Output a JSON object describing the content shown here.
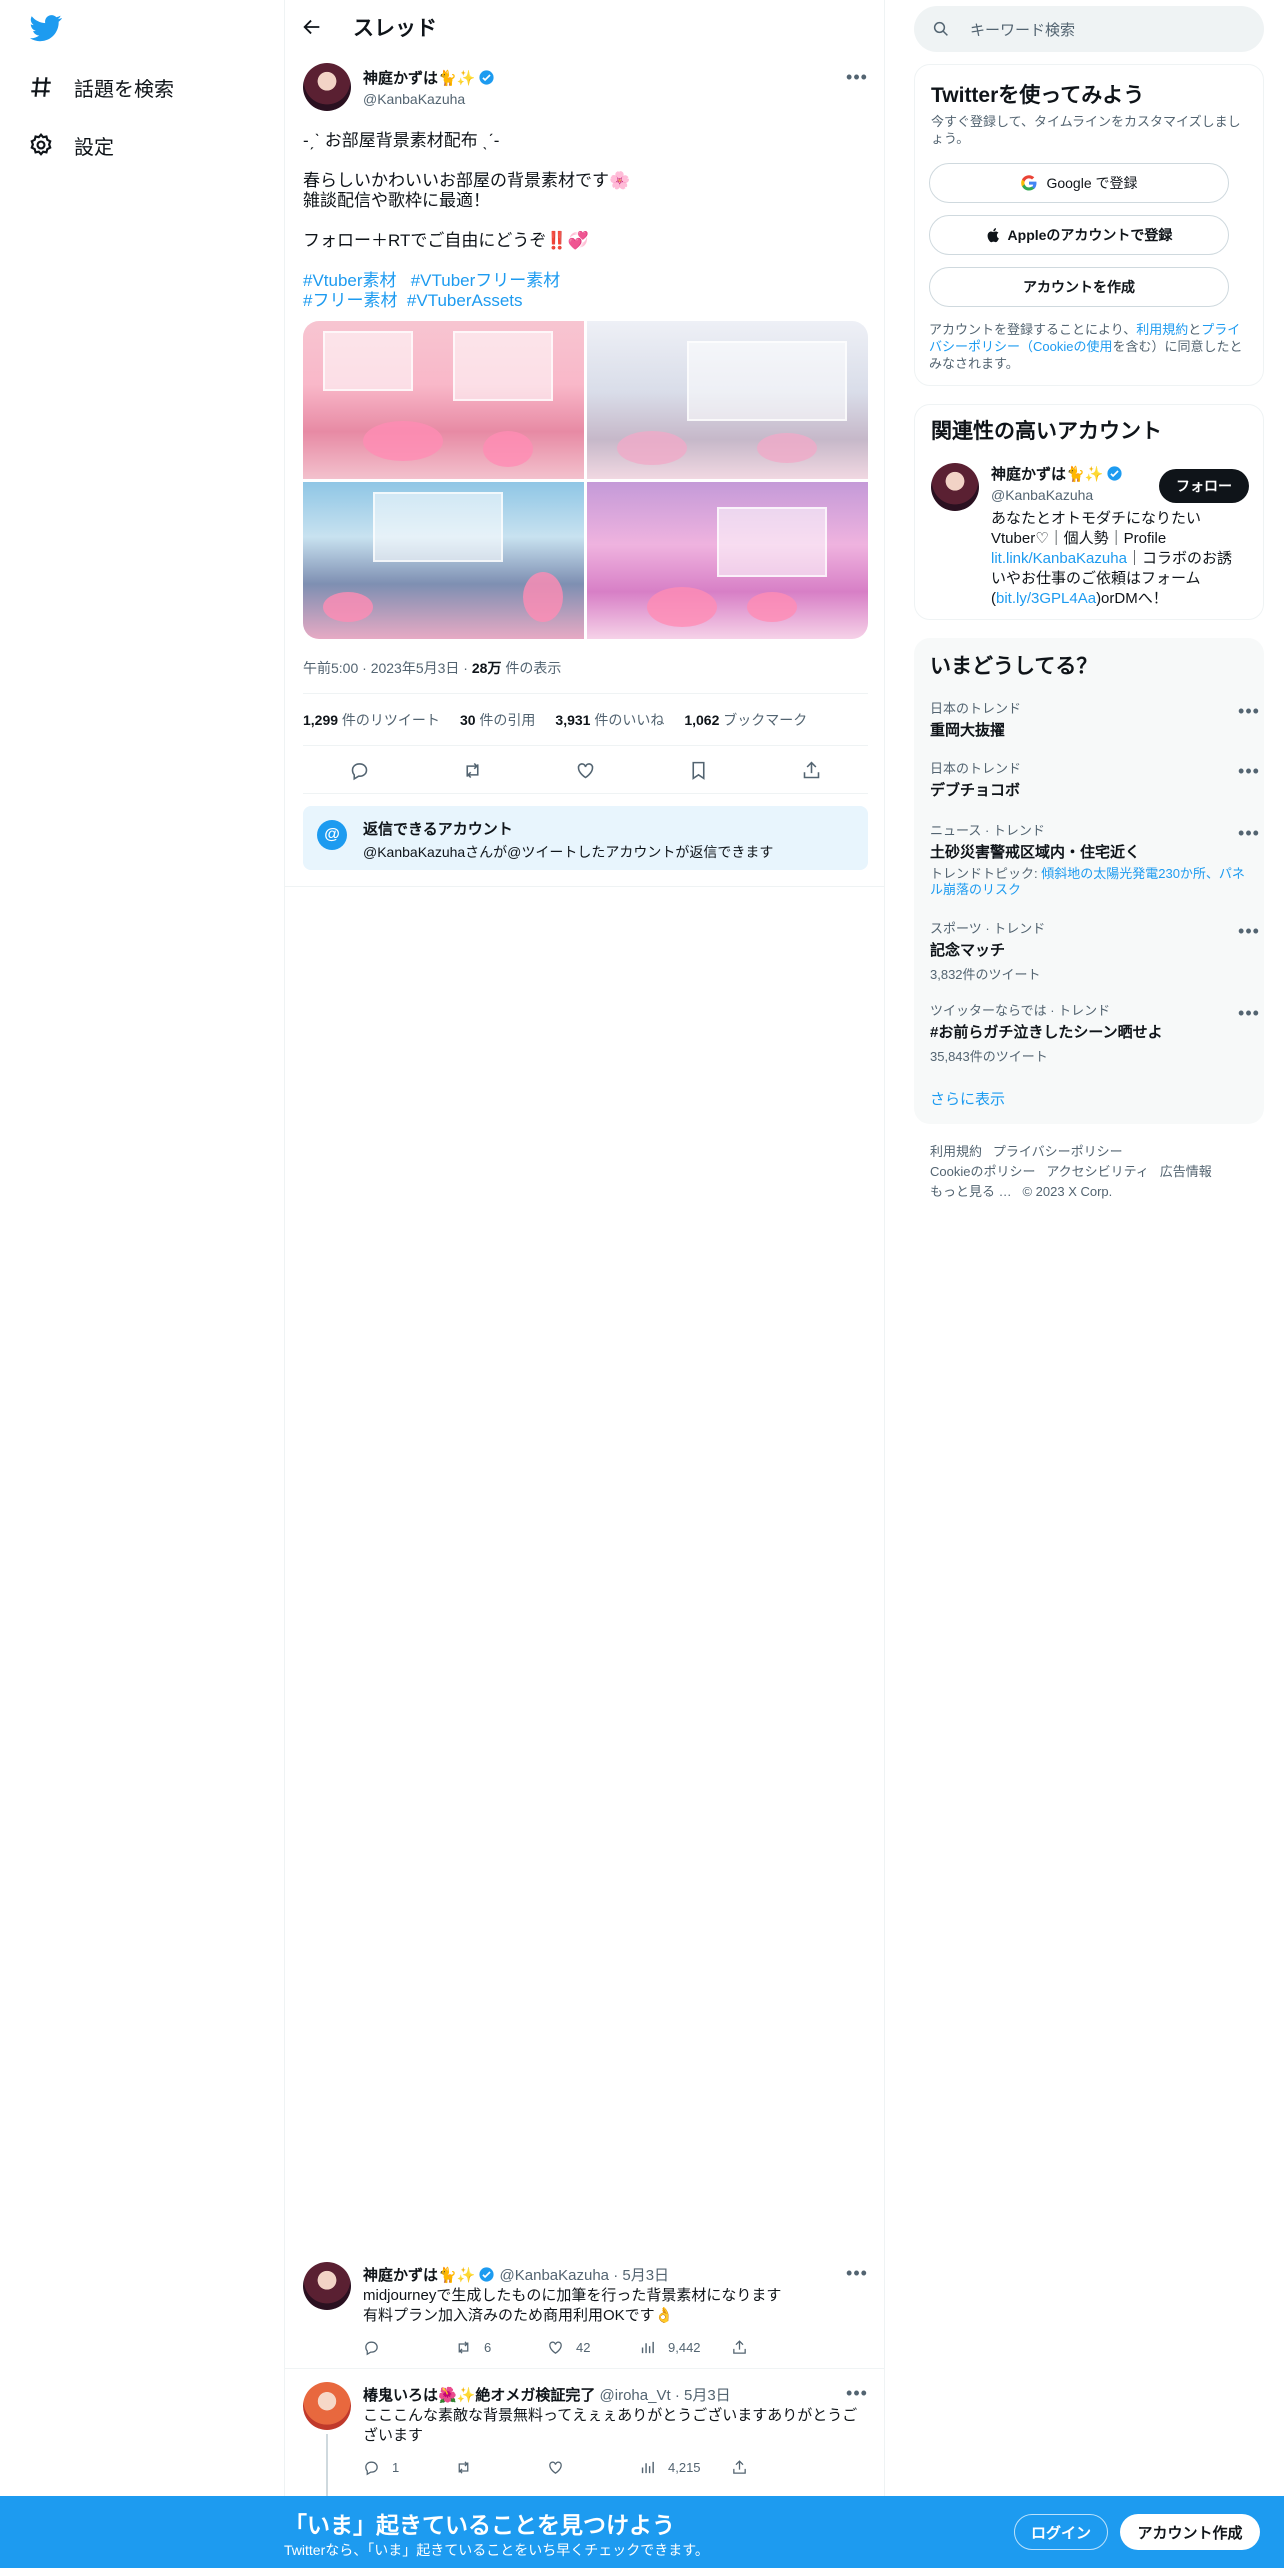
{
  "nav": {
    "explore": "話題を検索",
    "settings": "設定"
  },
  "header": {
    "title": "スレッド"
  },
  "tweet": {
    "name": "神庭かずは🐈✨",
    "handle": "@KanbaKazuha",
    "lines": [
      "-ˏˋ お部屋背景素材配布 ˎˊ-",
      "",
      "春らしいかわいいお部屋の背景素材です🌸",
      "雑談配信や歌枠に最適！",
      "",
      "フォロー＋RTでご自由にどうぞ‼️💞"
    ],
    "hashtags": [
      "#Vtuber素材",
      "#VTuberフリー素材",
      "#フリー素材",
      "#VTuberAssets"
    ],
    "time": "午前5:00",
    "date": "2023年5月3日",
    "views_num": "28万",
    "views_label": " 件の表示",
    "stats": [
      {
        "num": "1,299",
        "label": " 件のリツイート"
      },
      {
        "num": "30",
        "label": " 件の引用"
      },
      {
        "num": "3,931",
        "label": " 件のいいね"
      },
      {
        "num": "1,062",
        "label": " ブックマーク"
      }
    ]
  },
  "reply_restriction": {
    "title": "返信できるアカウント",
    "text": "@KanbaKazuhaさんが@ツイートしたアカウントが返信できます"
  },
  "replies": [
    {
      "name": "神庭かずは🐈✨",
      "handle": "@KanbaKazuha",
      "date": "5月3日",
      "line1": "midjourneyで生成したものに加筆を行った背景素材になります",
      "line2": "有料プラン加入済みのため商用利用OKです👌",
      "reply_count": "",
      "retweets": "6",
      "likes": "42",
      "views": "9,442"
    },
    {
      "name": "椿鬼いろは🌺✨絶オメガ検証完了",
      "handle": "@iroha_Vt",
      "date": "5月3日",
      "line1": "こここんな素敵な背景無料ってえぇぇありがとうございますありがとうご",
      "line2": "ざいます",
      "reply_count": "1",
      "retweets": "",
      "likes": "",
      "views": "4,215"
    }
  ],
  "right": {
    "search_placeholder": "キーワード検索",
    "signup": {
      "title": "Twitterを使ってみよう",
      "subtitle": "今すぐ登録して、タイムラインをカスタマイズしましょう。",
      "google": "Google で登録",
      "apple": "Appleのアカウントで登録",
      "create": "アカウントを作成",
      "terms_pre": "アカウントを登録することにより、",
      "terms_link1": "利用規約",
      "terms_and": "と",
      "terms_link2": "プライバシーポリシー（Cookieの使用",
      "terms_post": "を含む）に同意したとみなされます。"
    },
    "related": {
      "title": "関連性の高いアカウント",
      "name": "神庭かずは🐈✨",
      "handle": "@KanbaKazuha",
      "follow": "フォロー",
      "bio1": "あなたとオトモダチになりたい",
      "bio2": "Vtuber♡｜個人勢｜Profile",
      "bio_link1": "lit.link/KanbaKazuha",
      "bio3": "｜コラボのお誘",
      "bio4": "いやお仕事のご依頼はフォーム",
      "bio_link2_pre": "(",
      "bio_link2": "bit.ly/3GPL4Aa",
      "bio5": ")orDMへ！"
    },
    "trends": {
      "title": "いまどうしてる？",
      "items": [
        {
          "cat": "日本のトレンド",
          "name": "重岡大抜擢",
          "extra": "",
          "count": ""
        },
        {
          "cat": "日本のトレンド",
          "name": "デブチョコボ",
          "extra": "",
          "count": ""
        },
        {
          "cat": "ニュース · トレンド",
          "name": "土砂災害警戒区域内・住宅近く",
          "extra_pre": "トレンドトピック: ",
          "extra": "傾斜地の太陽光発電230か所、パネル崩落のリスク",
          "count": ""
        },
        {
          "cat": "スポーツ · トレンド",
          "name": "記念マッチ",
          "extra": "",
          "count": "3,832件のツイート"
        },
        {
          "cat": "ツイッターならでは · トレンド",
          "name": "#お前らガチ泣きしたシーン晒せよ",
          "extra": "",
          "count": "35,843件のツイート"
        }
      ],
      "more": "さらに表示"
    },
    "footer": {
      "l1": [
        "利用規約",
        "プライバシーポリシー"
      ],
      "l2": [
        "Cookieのポリシー",
        "アクセシビリティ",
        "広告情報"
      ],
      "l3": [
        "もっと見る …",
        "© 2023 X Corp."
      ]
    }
  },
  "bottom_bar": {
    "title": "「いま」起きていることを見つけよう",
    "subtitle": "Twitterなら、「いま」起きていることをいち早くチェックできます。",
    "login": "ログイン",
    "signup": "アカウント作成"
  },
  "colors": {
    "accent": "#1d9bf0",
    "text": "#0f1419",
    "secondary": "#536471"
  }
}
